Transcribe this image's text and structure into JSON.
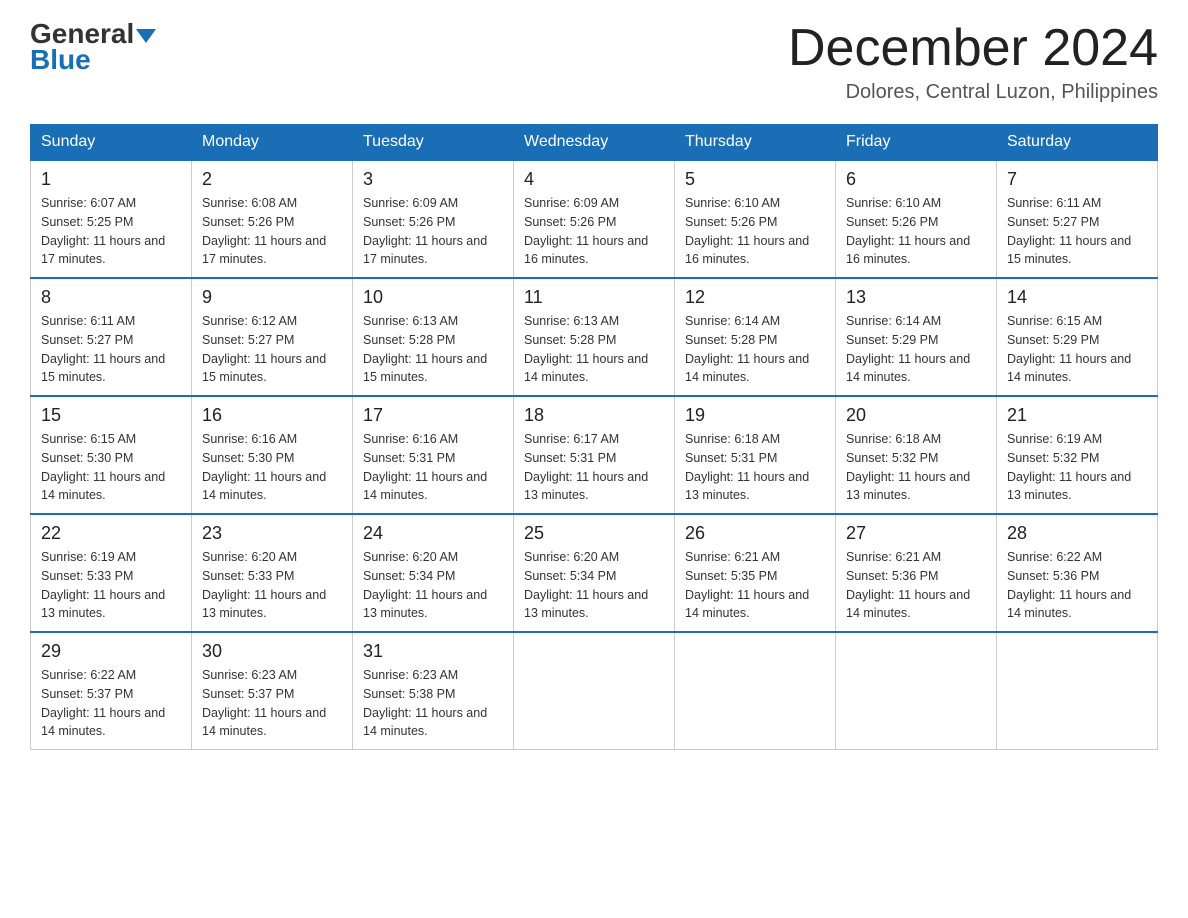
{
  "header": {
    "logo_general": "General",
    "logo_blue": "Blue",
    "month_title": "December 2024",
    "location": "Dolores, Central Luzon, Philippines"
  },
  "weekdays": [
    "Sunday",
    "Monday",
    "Tuesday",
    "Wednesday",
    "Thursday",
    "Friday",
    "Saturday"
  ],
  "weeks": [
    [
      {
        "day": "1",
        "sunrise": "6:07 AM",
        "sunset": "5:25 PM",
        "daylight": "11 hours and 17 minutes."
      },
      {
        "day": "2",
        "sunrise": "6:08 AM",
        "sunset": "5:26 PM",
        "daylight": "11 hours and 17 minutes."
      },
      {
        "day": "3",
        "sunrise": "6:09 AM",
        "sunset": "5:26 PM",
        "daylight": "11 hours and 17 minutes."
      },
      {
        "day": "4",
        "sunrise": "6:09 AM",
        "sunset": "5:26 PM",
        "daylight": "11 hours and 16 minutes."
      },
      {
        "day": "5",
        "sunrise": "6:10 AM",
        "sunset": "5:26 PM",
        "daylight": "11 hours and 16 minutes."
      },
      {
        "day": "6",
        "sunrise": "6:10 AM",
        "sunset": "5:26 PM",
        "daylight": "11 hours and 16 minutes."
      },
      {
        "day": "7",
        "sunrise": "6:11 AM",
        "sunset": "5:27 PM",
        "daylight": "11 hours and 15 minutes."
      }
    ],
    [
      {
        "day": "8",
        "sunrise": "6:11 AM",
        "sunset": "5:27 PM",
        "daylight": "11 hours and 15 minutes."
      },
      {
        "day": "9",
        "sunrise": "6:12 AM",
        "sunset": "5:27 PM",
        "daylight": "11 hours and 15 minutes."
      },
      {
        "day": "10",
        "sunrise": "6:13 AM",
        "sunset": "5:28 PM",
        "daylight": "11 hours and 15 minutes."
      },
      {
        "day": "11",
        "sunrise": "6:13 AM",
        "sunset": "5:28 PM",
        "daylight": "11 hours and 14 minutes."
      },
      {
        "day": "12",
        "sunrise": "6:14 AM",
        "sunset": "5:28 PM",
        "daylight": "11 hours and 14 minutes."
      },
      {
        "day": "13",
        "sunrise": "6:14 AM",
        "sunset": "5:29 PM",
        "daylight": "11 hours and 14 minutes."
      },
      {
        "day": "14",
        "sunrise": "6:15 AM",
        "sunset": "5:29 PM",
        "daylight": "11 hours and 14 minutes."
      }
    ],
    [
      {
        "day": "15",
        "sunrise": "6:15 AM",
        "sunset": "5:30 PM",
        "daylight": "11 hours and 14 minutes."
      },
      {
        "day": "16",
        "sunrise": "6:16 AM",
        "sunset": "5:30 PM",
        "daylight": "11 hours and 14 minutes."
      },
      {
        "day": "17",
        "sunrise": "6:16 AM",
        "sunset": "5:31 PM",
        "daylight": "11 hours and 14 minutes."
      },
      {
        "day": "18",
        "sunrise": "6:17 AM",
        "sunset": "5:31 PM",
        "daylight": "11 hours and 13 minutes."
      },
      {
        "day": "19",
        "sunrise": "6:18 AM",
        "sunset": "5:31 PM",
        "daylight": "11 hours and 13 minutes."
      },
      {
        "day": "20",
        "sunrise": "6:18 AM",
        "sunset": "5:32 PM",
        "daylight": "11 hours and 13 minutes."
      },
      {
        "day": "21",
        "sunrise": "6:19 AM",
        "sunset": "5:32 PM",
        "daylight": "11 hours and 13 minutes."
      }
    ],
    [
      {
        "day": "22",
        "sunrise": "6:19 AM",
        "sunset": "5:33 PM",
        "daylight": "11 hours and 13 minutes."
      },
      {
        "day": "23",
        "sunrise": "6:20 AM",
        "sunset": "5:33 PM",
        "daylight": "11 hours and 13 minutes."
      },
      {
        "day": "24",
        "sunrise": "6:20 AM",
        "sunset": "5:34 PM",
        "daylight": "11 hours and 13 minutes."
      },
      {
        "day": "25",
        "sunrise": "6:20 AM",
        "sunset": "5:34 PM",
        "daylight": "11 hours and 13 minutes."
      },
      {
        "day": "26",
        "sunrise": "6:21 AM",
        "sunset": "5:35 PM",
        "daylight": "11 hours and 14 minutes."
      },
      {
        "day": "27",
        "sunrise": "6:21 AM",
        "sunset": "5:36 PM",
        "daylight": "11 hours and 14 minutes."
      },
      {
        "day": "28",
        "sunrise": "6:22 AM",
        "sunset": "5:36 PM",
        "daylight": "11 hours and 14 minutes."
      }
    ],
    [
      {
        "day": "29",
        "sunrise": "6:22 AM",
        "sunset": "5:37 PM",
        "daylight": "11 hours and 14 minutes."
      },
      {
        "day": "30",
        "sunrise": "6:23 AM",
        "sunset": "5:37 PM",
        "daylight": "11 hours and 14 minutes."
      },
      {
        "day": "31",
        "sunrise": "6:23 AM",
        "sunset": "5:38 PM",
        "daylight": "11 hours and 14 minutes."
      },
      null,
      null,
      null,
      null
    ]
  ],
  "colors": {
    "header_bg": "#1a6eb5",
    "accent_blue": "#1a6eb5"
  }
}
